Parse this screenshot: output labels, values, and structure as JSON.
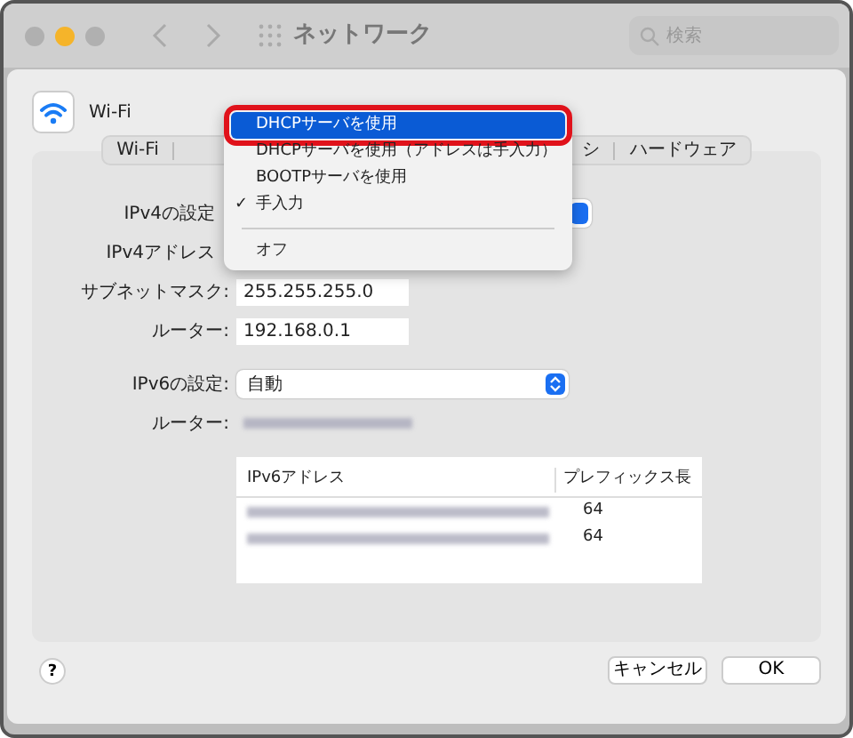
{
  "window": {
    "title": "ネットワーク",
    "search": {
      "placeholder": "検索"
    }
  },
  "service": {
    "name": "Wi-Fi"
  },
  "tabs": [
    {
      "label": "Wi-Fi",
      "selected": false
    },
    {
      "label": "シ",
      "selected": false
    },
    {
      "label": "ハードウェア",
      "selected": false
    }
  ],
  "ipv4": {
    "config_label": "IPv4の設定",
    "address_label": "IPv4アドレス",
    "subnet_label": "サブネットマスク:",
    "subnet": "255.255.255.0",
    "router_label": "ルーター:",
    "router": "192.168.0.1"
  },
  "ipv6": {
    "config_label": "IPv6の設定:",
    "config": "自動",
    "router_label": "ルーター:",
    "router_blurred": true,
    "table": {
      "columns": [
        "IPv6アドレス",
        "プレフィックス長"
      ],
      "rows": [
        {
          "address_blurred": true,
          "prefix": "64"
        },
        {
          "address_blurred": true,
          "prefix": "64"
        }
      ]
    }
  },
  "menu": {
    "check_mark": "✓",
    "items": [
      {
        "kind": "item",
        "label": "DHCPサーバを使用",
        "selected": true,
        "checked": false
      },
      {
        "kind": "item",
        "label": "DHCPサーバを使用（アドレスは手入力）",
        "selected": false,
        "checked": false
      },
      {
        "kind": "item",
        "label": "BOOTPサーバを使用",
        "selected": false,
        "checked": false
      },
      {
        "kind": "item",
        "label": "手入力",
        "selected": false,
        "checked": true
      },
      {
        "kind": "separator"
      },
      {
        "kind": "item",
        "label": "オフ",
        "selected": false,
        "checked": false
      }
    ]
  },
  "help": "?",
  "buttons": [
    {
      "label": "キャンセル"
    },
    {
      "label": "OK"
    }
  ]
}
